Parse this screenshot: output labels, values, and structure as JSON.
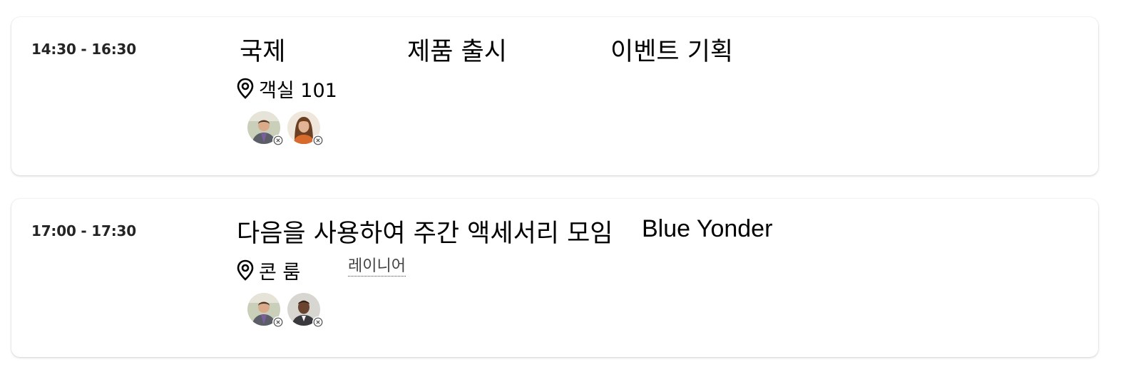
{
  "events": [
    {
      "time": "14:30 - 16:30",
      "title_parts": [
        "국제",
        "제품 출시",
        "이벤트 기획"
      ],
      "location": "객실 101",
      "location_link": "",
      "attendees": [
        "attendee-man-suit",
        "attendee-woman-brown-hair"
      ]
    },
    {
      "time": "17:00 - 17:30",
      "title_parts": [
        "다음을 사용하여 주간 액세서리 모임",
        "Blue Yonder"
      ],
      "location": "콘 룸",
      "location_link": "레이니어",
      "attendees": [
        "attendee-man-suit",
        "attendee-man-dark-skin"
      ]
    }
  ],
  "icons": {
    "location": "location-pin-icon",
    "remove": "remove-circle-icon"
  },
  "colors": {
    "card_background": "#ffffff",
    "text": "#000000",
    "time_text": "#242424"
  }
}
